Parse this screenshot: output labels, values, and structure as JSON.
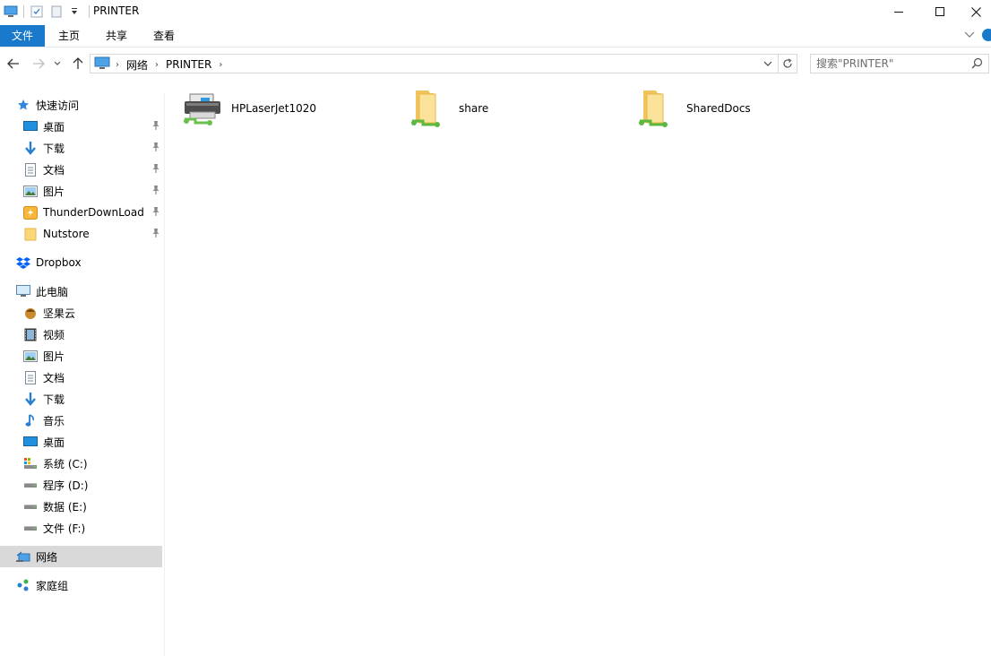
{
  "window": {
    "title": "PRINTER"
  },
  "ribbon": {
    "tabs": [
      "文件",
      "主页",
      "共享",
      "查看"
    ]
  },
  "address": {
    "crumbs": [
      "网络",
      "PRINTER"
    ]
  },
  "search": {
    "placeholder": "搜索\"PRINTER\""
  },
  "sidebar": {
    "quick_access": {
      "label": "快速访问",
      "items": [
        {
          "label": "桌面",
          "icon": "desktop-icon"
        },
        {
          "label": "下载",
          "icon": "download-icon"
        },
        {
          "label": "文档",
          "icon": "document-icon"
        },
        {
          "label": "图片",
          "icon": "pictures-icon"
        },
        {
          "label": "ThunderDownLoad",
          "icon": "thunder-folder-icon"
        },
        {
          "label": "Nutstore",
          "icon": "folder-icon"
        }
      ]
    },
    "dropbox": {
      "label": "Dropbox"
    },
    "this_pc": {
      "label": "此电脑",
      "items": [
        {
          "label": "坚果云",
          "icon": "nutstore-icon"
        },
        {
          "label": "视频",
          "icon": "video-icon"
        },
        {
          "label": "图片",
          "icon": "pictures-icon"
        },
        {
          "label": "文档",
          "icon": "document-icon"
        },
        {
          "label": "下载",
          "icon": "download-icon"
        },
        {
          "label": "音乐",
          "icon": "music-icon"
        },
        {
          "label": "桌面",
          "icon": "desktop-icon"
        },
        {
          "label": "系统 (C:)",
          "icon": "system-drive-icon"
        },
        {
          "label": "程序 (D:)",
          "icon": "drive-icon"
        },
        {
          "label": "数据 (E:)",
          "icon": "drive-icon"
        },
        {
          "label": "文件 (F:)",
          "icon": "drive-icon"
        }
      ]
    },
    "network": {
      "label": "网络"
    },
    "homegroup": {
      "label": "家庭组"
    }
  },
  "content": {
    "items": [
      {
        "label": "HPLaserJet1020",
        "icon": "network-printer-icon"
      },
      {
        "label": "share",
        "icon": "shared-folder-icon"
      },
      {
        "label": "SharedDocs",
        "icon": "shared-folder-icon"
      }
    ]
  },
  "colors": {
    "accent": "#1979ca",
    "selected": "#d9d9d9"
  }
}
